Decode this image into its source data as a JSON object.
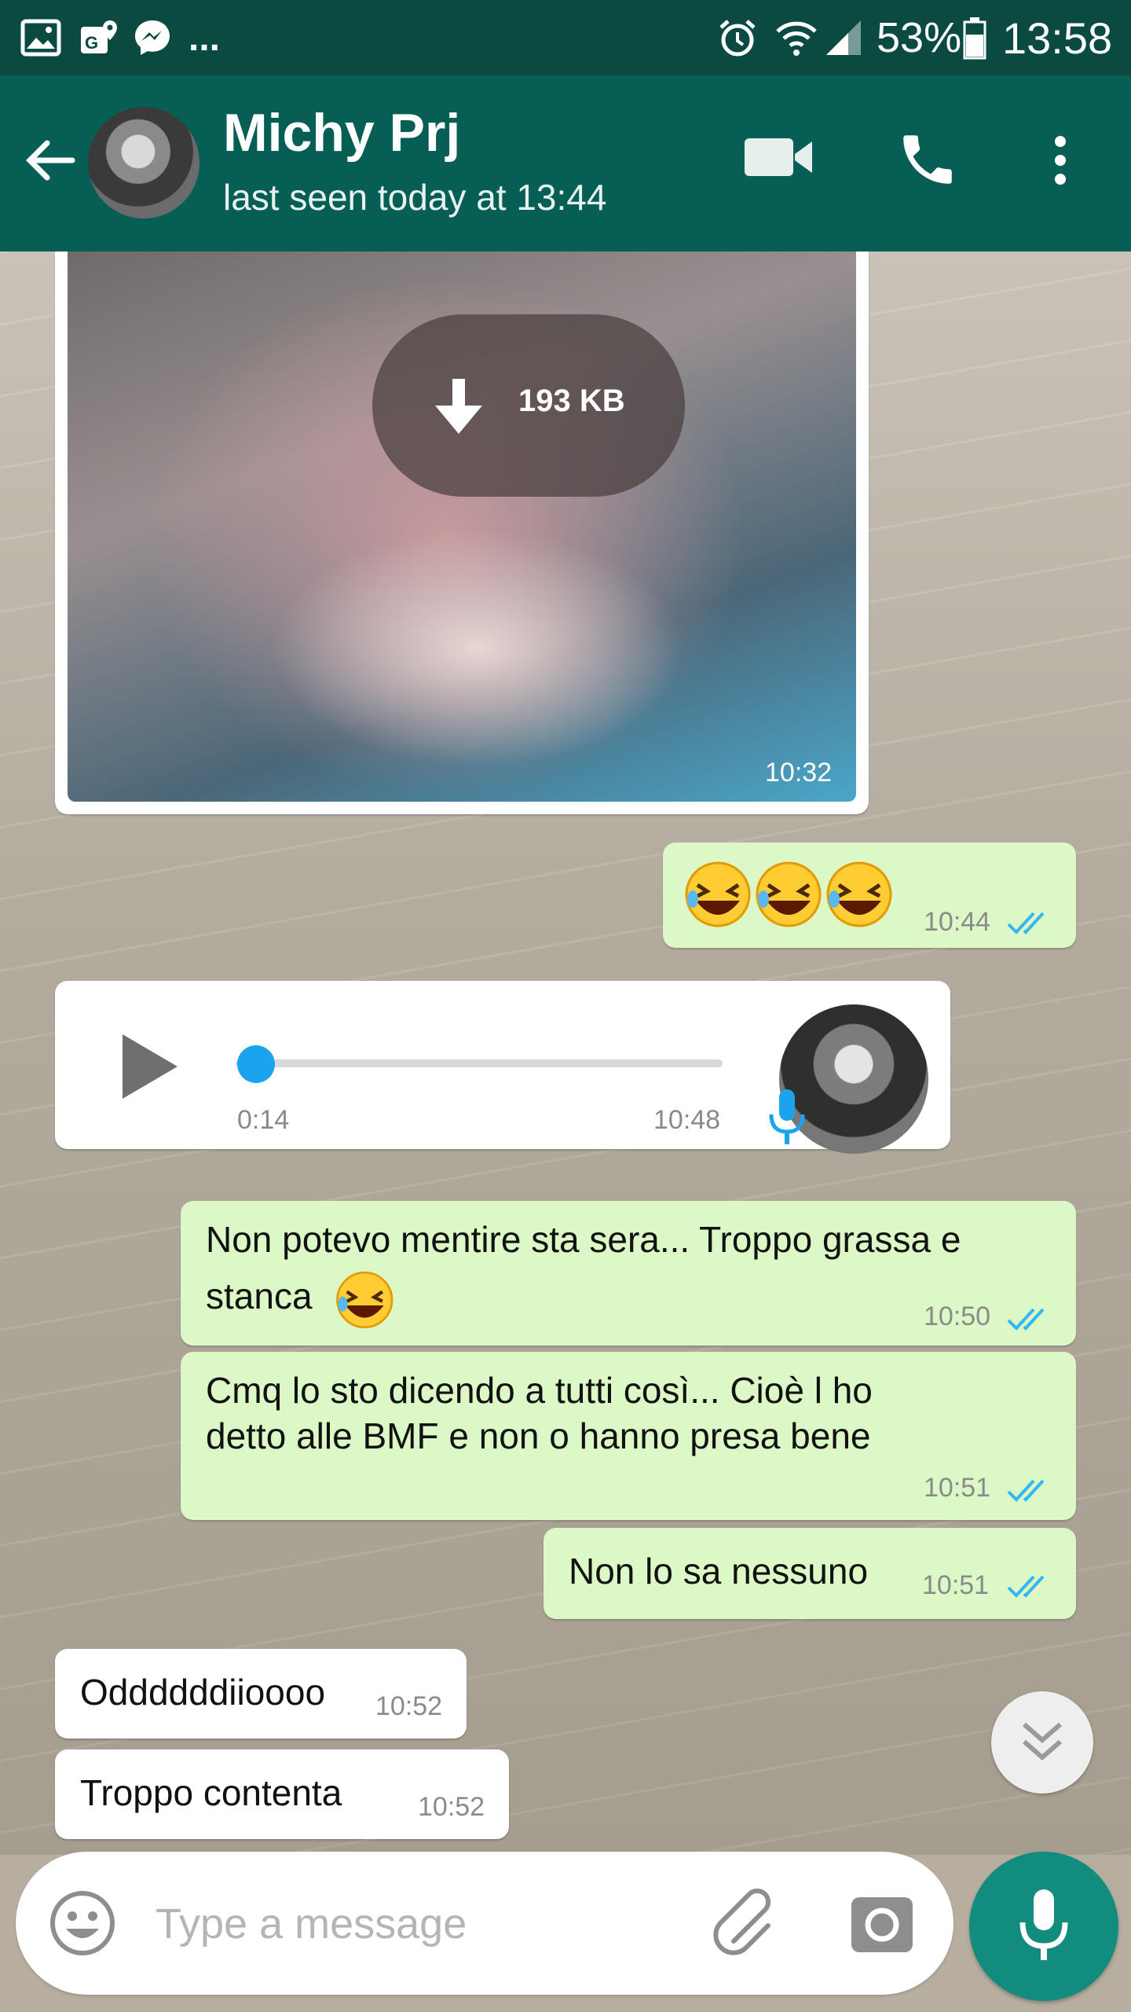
{
  "status_bar": {
    "battery": "53%",
    "time": "13:58",
    "more_indicator": "..."
  },
  "header": {
    "contact_name": "Michy Prj",
    "last_seen": "last seen today at 13:44"
  },
  "messages": {
    "image": {
      "size": "193 KB",
      "time": "10:32"
    },
    "emoji": {
      "time": "10:44"
    },
    "voice": {
      "duration": "0:14",
      "time": "10:48",
      "progress": 0.0
    },
    "m1": {
      "line1": "Non potevo mentire sta sera... Troppo grassa e",
      "line2": "stanca",
      "time": "10:50"
    },
    "m2": {
      "line1": "Cmq lo sto dicendo a tutti così... Cioè l ho",
      "line2": "detto alle BMF e non o hanno presa bene",
      "time": "10:51"
    },
    "m3": {
      "text": "Non lo sa nessuno",
      "time": "10:51"
    },
    "m4": {
      "text": "Oddddddiioooo",
      "time": "10:52"
    },
    "m5": {
      "text": "Troppo contenta",
      "time": "10:52"
    }
  },
  "input": {
    "placeholder": "Type a message"
  },
  "colors": {
    "header": "#075e54",
    "status_bar": "#0a4a40",
    "outgoing_bubble": "#dcf8c6",
    "incoming_bubble": "#ffffff",
    "read_ticks": "#34b7f1",
    "mic_button": "#128c7e"
  },
  "icons": [
    "gallery-icon",
    "maps-icon",
    "messenger-icon",
    "alarm-icon",
    "wifi-icon",
    "signal-icon",
    "battery-icon",
    "back-arrow-icon",
    "video-call-icon",
    "phone-icon",
    "more-icon",
    "download-icon",
    "play-icon",
    "mic-icon",
    "emoji-icon",
    "attach-icon",
    "camera-icon",
    "chevron-down-icon"
  ]
}
